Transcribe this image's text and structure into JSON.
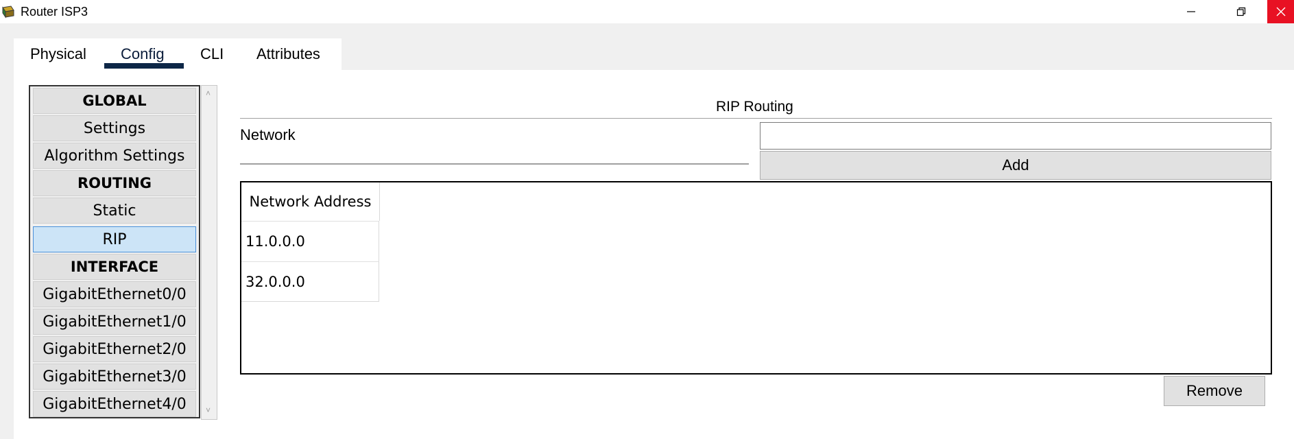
{
  "window": {
    "title": "Router ISP3",
    "app_icon": "router-app-icon",
    "controls": {
      "minimize": "minimize-icon",
      "restore": "restore-icon",
      "close": "close-icon"
    },
    "close_color": "#e81123"
  },
  "tabs": [
    {
      "label": "Physical",
      "active": false
    },
    {
      "label": "Config",
      "active": true
    },
    {
      "label": "CLI",
      "active": false
    },
    {
      "label": "Attributes",
      "active": false
    }
  ],
  "sidebar": {
    "items": [
      {
        "label": "GLOBAL",
        "type": "header"
      },
      {
        "label": "Settings",
        "type": "item"
      },
      {
        "label": "Algorithm Settings",
        "type": "item"
      },
      {
        "label": "ROUTING",
        "type": "header"
      },
      {
        "label": "Static",
        "type": "item"
      },
      {
        "label": "RIP",
        "type": "item",
        "selected": true
      },
      {
        "label": "INTERFACE",
        "type": "header"
      },
      {
        "label": "GigabitEthernet0/0",
        "type": "item"
      },
      {
        "label": "GigabitEthernet1/0",
        "type": "item"
      },
      {
        "label": "GigabitEthernet2/0",
        "type": "item"
      },
      {
        "label": "GigabitEthernet3/0",
        "type": "item"
      },
      {
        "label": "GigabitEthernet4/0",
        "type": "item"
      }
    ]
  },
  "rip": {
    "title": "RIP Routing",
    "network_label": "Network",
    "network_value": "",
    "add_label": "Add",
    "table": {
      "header": "Network Address",
      "rows": [
        "11.0.0.0",
        "32.0.0.0"
      ]
    },
    "remove_label": "Remove"
  },
  "colors": {
    "selected_bg": "#cce4f7",
    "tab_underline": "#0d2747"
  }
}
